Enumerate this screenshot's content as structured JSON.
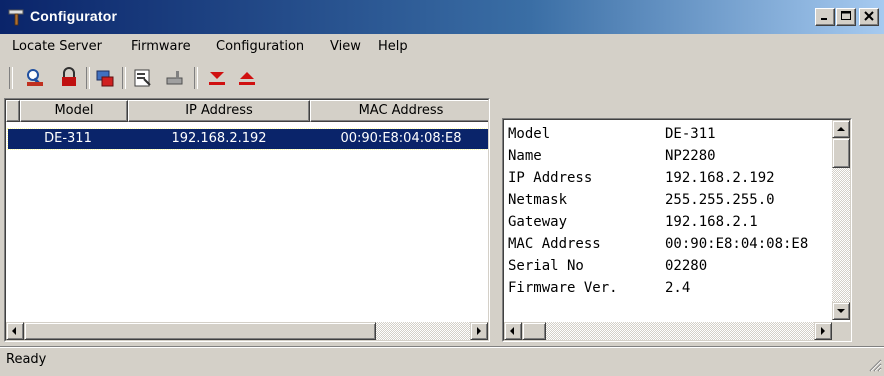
{
  "window": {
    "title": "Configurator",
    "title_icon": "hammer-app-icon",
    "controls": {
      "minimize": "minimize-icon",
      "maximize": "maximize-icon",
      "close": "close-icon"
    }
  },
  "menu": [
    {
      "label": "Locate Server"
    },
    {
      "label": "Firmware"
    },
    {
      "label": "Configuration"
    },
    {
      "label": "View"
    },
    {
      "label": "Help"
    }
  ],
  "toolbar": {
    "tools": [
      {
        "name": "locate-server-icon"
      },
      {
        "name": "unlock-server-icon"
      },
      {
        "name": "upgrade-firmware-icon"
      },
      {
        "name": "configuration-properties-icon"
      },
      {
        "name": "network-settings-icon"
      },
      {
        "name": "download-icon"
      },
      {
        "name": "upload-icon"
      }
    ]
  },
  "server_list": {
    "columns": [
      "Model",
      "IP Address",
      "MAC Address"
    ],
    "rows": [
      {
        "model": "DE-311",
        "ip": "192.168.2.192",
        "mac": "00:90:E8:04:08:E8",
        "selected": true
      }
    ]
  },
  "details": {
    "rows": [
      {
        "label": "Model",
        "value": "DE-311"
      },
      {
        "label": "Name",
        "value": "NP2280"
      },
      {
        "label": "IP Address",
        "value": "192.168.2.192"
      },
      {
        "label": "Netmask",
        "value": "255.255.255.0"
      },
      {
        "label": "Gateway",
        "value": "192.168.2.1"
      },
      {
        "label": "MAC Address",
        "value": "00:90:E8:04:08:E8"
      },
      {
        "label": "Serial No",
        "value": "02280"
      },
      {
        "label": "Firmware Ver.",
        "value": "2.4"
      }
    ]
  },
  "status": {
    "text": "Ready"
  },
  "colors": {
    "titlebar_start": "#0a246a",
    "titlebar_end": "#a6caf0",
    "selection": "#0a246a",
    "face": "#d4d0c8"
  }
}
